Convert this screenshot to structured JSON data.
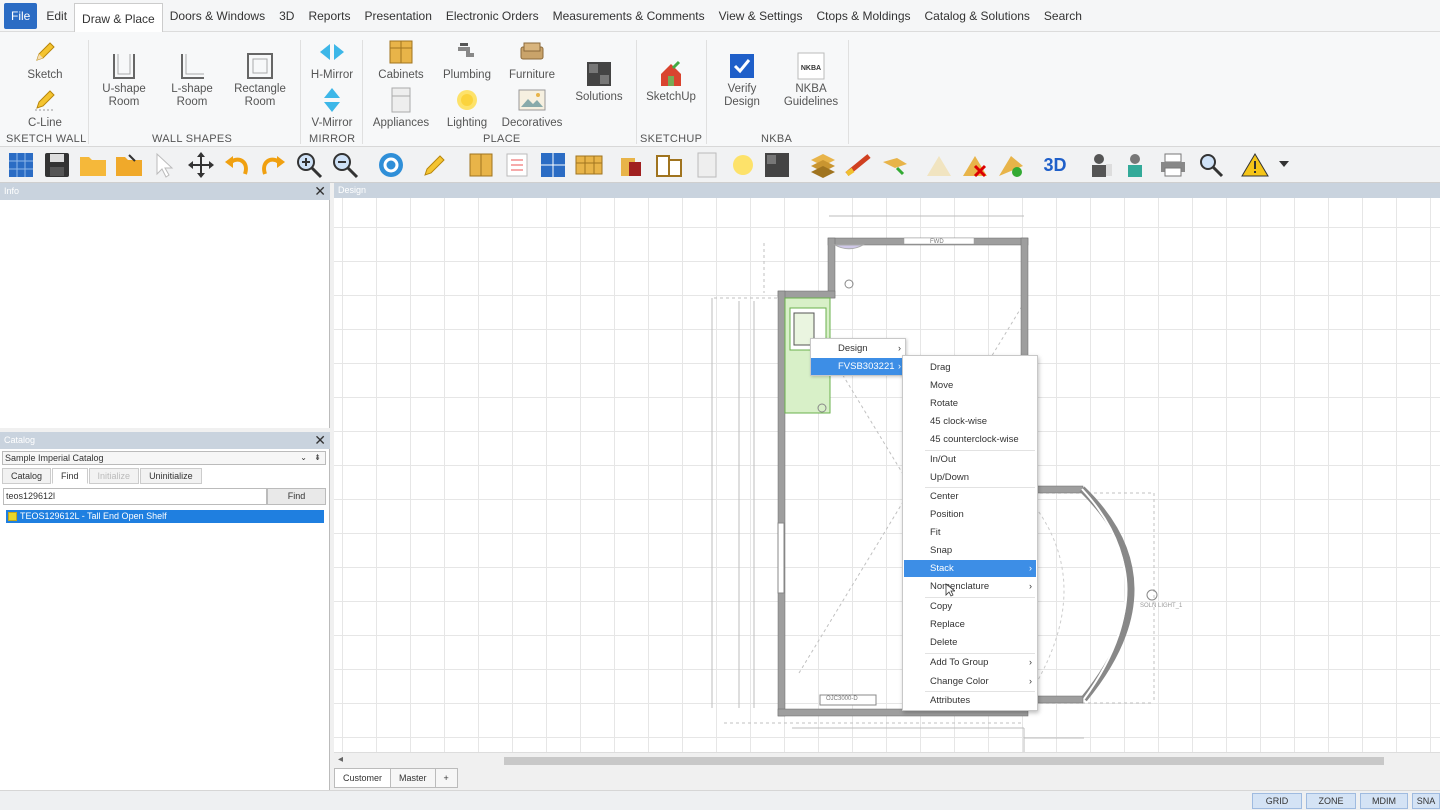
{
  "menu": [
    "File",
    "Edit",
    "Draw & Place",
    "Doors & Windows",
    "3D",
    "Reports",
    "Presentation",
    "Electronic Orders",
    "Measurements & Comments",
    "View & Settings",
    "Ctops & Moldings",
    "Catalog & Solutions",
    "Search"
  ],
  "ribbon": {
    "sketch": "Sketch",
    "cline": "C-Line",
    "ushape": [
      "U-shape",
      "Room"
    ],
    "lshape": [
      "L-shape",
      "Room"
    ],
    "rect": [
      "Rectangle",
      "Room"
    ],
    "hmirror": "H-Mirror",
    "vmirror": "V-Mirror",
    "cabinets": "Cabinets",
    "plumbing": "Plumbing",
    "furniture": "Furniture",
    "appliances": "Appliances",
    "lighting": "Lighting",
    "decoratives": "Decoratives",
    "solutions": "Solutions",
    "sketchup": "SketchUp",
    "verify": [
      "Verify",
      "Design"
    ],
    "nkba": [
      "NKBA",
      "Guidelines"
    ],
    "nkba_logo": "NKBA",
    "groups": [
      "SKETCH WALL",
      "WALL SHAPES",
      "MIRROR",
      "PLACE",
      "SKETCHUP",
      "NKBA"
    ]
  },
  "toolbar_3d": "3D",
  "info_panel": {
    "title": "Info"
  },
  "catalog_panel": {
    "title": "Catalog",
    "selected_catalog": "Sample Imperial Catalog",
    "tabs": [
      "Catalog",
      "Find",
      "Initialize",
      "Uninitialize"
    ],
    "search_value": "teos129612l",
    "find_label": "Find",
    "result": "TEOS129612L - Tall End Open Shelf"
  },
  "design": {
    "title": "Design",
    "labels": {
      "fwd": "FWD",
      "wall_bottom": "OJC3000-D",
      "window": "SOLN LIGHT_1"
    }
  },
  "context_menu_1": [
    "Design",
    "FVSB303221"
  ],
  "context_menu_2": [
    {
      "label": "Drag"
    },
    {
      "label": "Move"
    },
    {
      "label": "Rotate"
    },
    {
      "label": "45 clock-wise"
    },
    {
      "label": "45 counterclock-wise"
    },
    {
      "label": "In/Out"
    },
    {
      "label": "Up/Down"
    },
    {
      "label": "Center"
    },
    {
      "label": "Position"
    },
    {
      "label": "Fit"
    },
    {
      "label": "Snap"
    },
    {
      "label": "Stack"
    },
    {
      "label": "Nomenclature"
    },
    {
      "label": "Copy"
    },
    {
      "label": "Replace"
    },
    {
      "label": "Delete"
    },
    {
      "label": "Add To Group"
    },
    {
      "label": "Change Color"
    },
    {
      "label": "Attributes"
    }
  ],
  "bottom_tabs": [
    "Customer",
    "Master",
    "+"
  ],
  "status": [
    "GRID",
    "ZONE",
    "MDIM",
    "SNA"
  ],
  "colors": {
    "accent": "#1f7fe0",
    "menu_highlight": "#3d8ee6",
    "file_button": "#2b6cc4",
    "panel_header": "#c9d3de"
  }
}
